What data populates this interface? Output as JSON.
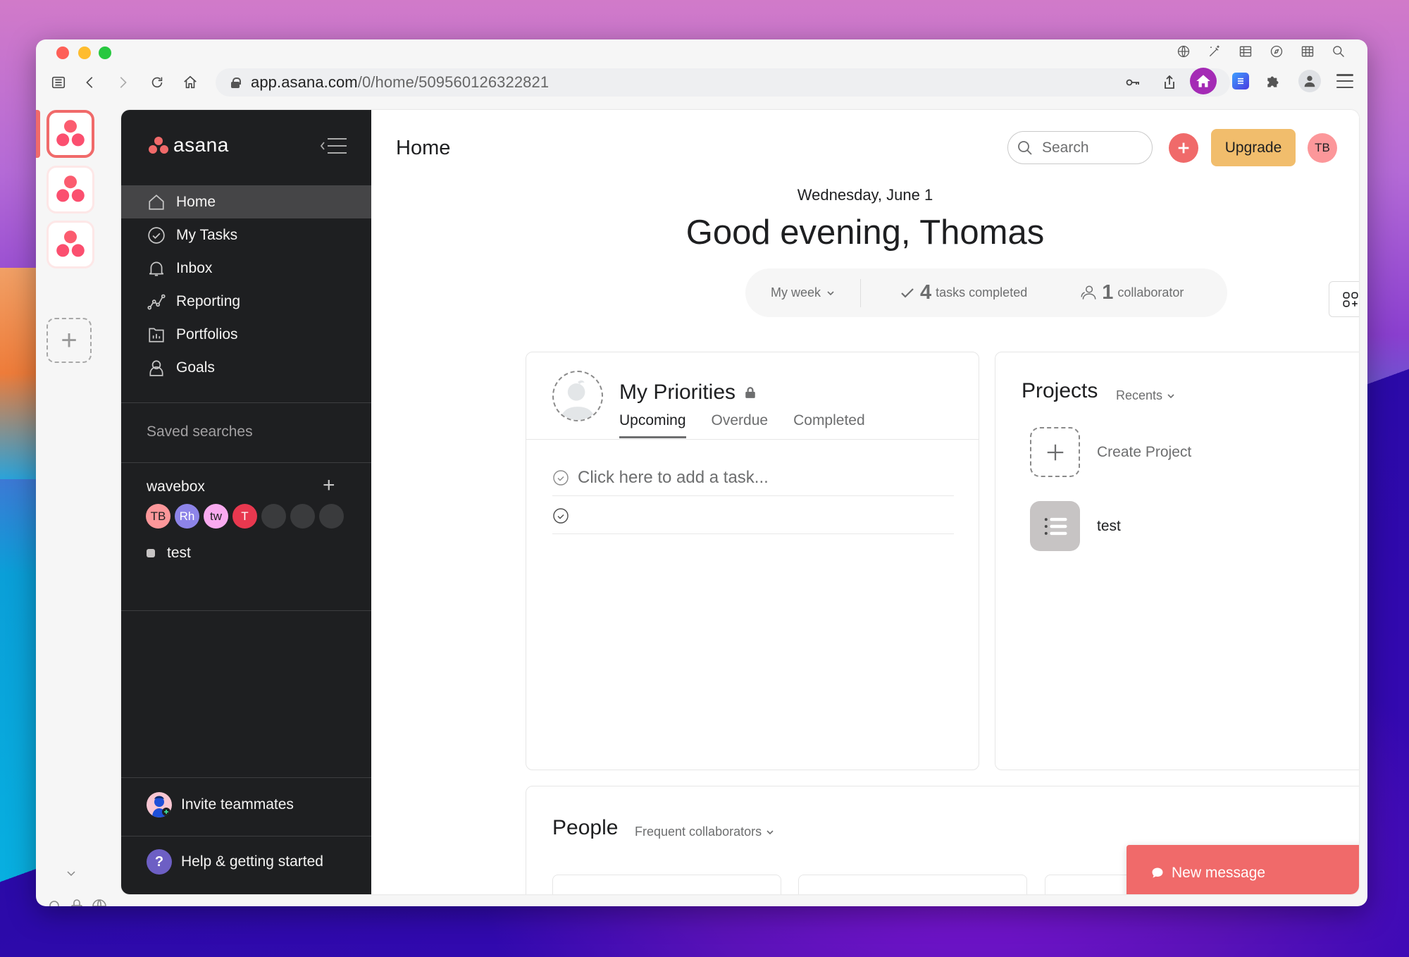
{
  "browser": {
    "url_host": "app.asana.com",
    "url_path": "/0/home/509560126322821",
    "top_icons": [
      "globe-icon",
      "magic-wand-icon",
      "table-icon",
      "compass-icon",
      "grid-icon",
      "search-icon"
    ],
    "nav_icons": [
      "sidebar-icon",
      "back-icon",
      "forward-icon",
      "reload-icon",
      "home-icon"
    ],
    "url_bar_icons": [
      "key-icon",
      "share-icon",
      "star-icon"
    ],
    "extension_icons": [
      "wavebox-home-icon",
      "docs-extension-icon",
      "puzzle-icon",
      "profile-icon",
      "menu-icon"
    ]
  },
  "rail": {
    "apps": [
      {
        "name": "asana",
        "active": true
      },
      {
        "name": "asana",
        "active": false
      },
      {
        "name": "asana",
        "active": false
      }
    ],
    "add_label": "+",
    "bottom_icons": [
      "bell-icon",
      "lock-icon",
      "globe-icon",
      "gift-icon",
      "help-icon",
      "settings-icon"
    ]
  },
  "sidebar": {
    "logo_text": "asana",
    "nav": [
      {
        "label": "Home",
        "icon": "home-icon",
        "active": true
      },
      {
        "label": "My Tasks",
        "icon": "check-circle-icon",
        "active": false
      },
      {
        "label": "Inbox",
        "icon": "bell-icon",
        "active": false
      },
      {
        "label": "Reporting",
        "icon": "chart-line-icon",
        "active": false
      },
      {
        "label": "Portfolios",
        "icon": "folder-chart-icon",
        "active": false
      },
      {
        "label": "Goals",
        "icon": "goal-person-icon",
        "active": false
      }
    ],
    "saved_searches": "Saved searches",
    "team": {
      "name": "wavebox",
      "add_label": "+",
      "members": [
        {
          "initials": "TB",
          "color": "#fc979a"
        },
        {
          "initials": "Rh",
          "color": "#8d84e8"
        },
        {
          "initials": "tw",
          "color": "#f9aaef"
        },
        {
          "initials": "T",
          "color": "#e8384f"
        },
        {
          "initials": "",
          "color": ""
        },
        {
          "initials": "",
          "color": ""
        },
        {
          "initials": "",
          "color": ""
        }
      ],
      "projects": [
        {
          "name": "test",
          "color": "#c7c4c4"
        }
      ]
    },
    "invite_label": "Invite teammates",
    "help_label": "Help & getting started",
    "help_icon_text": "?"
  },
  "header": {
    "title": "Home",
    "search_placeholder": "Search",
    "upgrade_label": "Upgrade",
    "user_initials": "TB"
  },
  "greeting": {
    "date": "Wednesday, June 1",
    "message": "Good evening, Thomas"
  },
  "stats": {
    "period": "My week",
    "tasks_count": "4",
    "tasks_label": "tasks completed",
    "collab_count": "1",
    "collab_label": "collaborator"
  },
  "customize_label": "Customize",
  "priorities": {
    "title": "My Priorities",
    "tabs": [
      {
        "label": "Upcoming",
        "active": true
      },
      {
        "label": "Overdue",
        "active": false
      },
      {
        "label": "Completed",
        "active": false
      }
    ],
    "add_task_placeholder": "Click here to add a task...",
    "tasks": [
      ""
    ]
  },
  "projects": {
    "title": "Projects",
    "filter": "Recents",
    "create_label": "Create Project",
    "items": [
      {
        "name": "test"
      }
    ]
  },
  "people": {
    "title": "People",
    "filter": "Frequent collaborators"
  },
  "new_message": {
    "label": "New message"
  },
  "colors": {
    "brand": "#f06a6a",
    "upgrade": "#f1bd6c",
    "sidebar_bg": "#1e1f21",
    "sidebar_active": "#454547",
    "help_purple": "#6d5fc4"
  }
}
